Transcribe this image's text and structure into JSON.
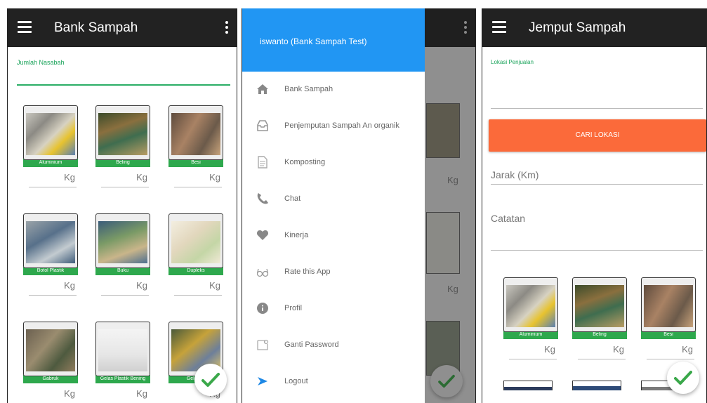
{
  "screen1": {
    "title": "Bank Sampah",
    "field_label": "Jumlah Nasabah",
    "unit": "Kg",
    "items": [
      {
        "name": "Aluminium"
      },
      {
        "name": "Beling"
      },
      {
        "name": "Besi"
      },
      {
        "name": "Botol Plastik"
      },
      {
        "name": "Buku"
      },
      {
        "name": "Dupleks"
      },
      {
        "name": "Gabruk"
      },
      {
        "name": "Gelas Plastik Bening"
      },
      {
        "name": "Gelas Pl"
      }
    ],
    "last_row_unit": "Kg"
  },
  "screen2": {
    "user": "iswanto (Bank Sampah Test)",
    "menu": [
      {
        "label": "Bank Sampah",
        "icon": "home-icon"
      },
      {
        "label": "Penjemputan Sampah An organik",
        "icon": "inbox-icon"
      },
      {
        "label": "Komposting",
        "icon": "document-icon"
      },
      {
        "label": "Chat",
        "icon": "phone-icon"
      },
      {
        "label": "Kinerja",
        "icon": "heart-icon"
      },
      {
        "label": "Rate this App",
        "icon": "glasses-icon"
      },
      {
        "label": "Profil",
        "icon": "info-icon"
      },
      {
        "label": "Ganti Password",
        "icon": "password-icon"
      },
      {
        "label": "Logout",
        "icon": "logout-arrow-icon"
      }
    ],
    "behind_unit": "Kg"
  },
  "screen3": {
    "title": "Jemput Sampah",
    "field_label": "Lokasi Penjualan",
    "button": "CARI LOKASI",
    "jarak_label": "Jarak (Km)",
    "catatan_label": "Catatan",
    "unit": "Kg",
    "items": [
      {
        "name": "Aluminium"
      },
      {
        "name": "Beling"
      },
      {
        "name": "Besi"
      }
    ]
  },
  "colors": {
    "appbar": "#222222",
    "accent_green": "#2ea84d",
    "drawer_header": "#2196f3",
    "button_orange": "#fb6a3a"
  }
}
